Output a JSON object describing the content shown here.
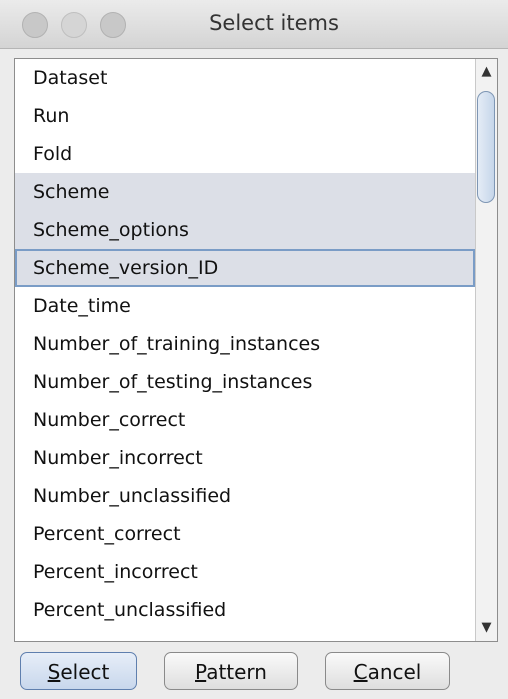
{
  "window": {
    "title": "Select items"
  },
  "list": {
    "items": [
      "Dataset",
      "Run",
      "Fold",
      "Scheme",
      "Scheme_options",
      "Scheme_version_ID",
      "Date_time",
      "Number_of_training_instances",
      "Number_of_testing_instances",
      "Number_correct",
      "Number_incorrect",
      "Number_unclassified",
      "Percent_correct",
      "Percent_incorrect",
      "Percent_unclassified"
    ],
    "selected_indices": [
      3,
      4,
      5
    ],
    "focused_index": 5
  },
  "scrollbar": {
    "up_icon": "▲",
    "down_icon": "▼"
  },
  "buttons": {
    "select": {
      "mnemonic": "S",
      "rest": "elect"
    },
    "pattern": {
      "mnemonic": "P",
      "rest": "attern"
    },
    "cancel": {
      "mnemonic": "C",
      "rest": "ancel"
    }
  }
}
